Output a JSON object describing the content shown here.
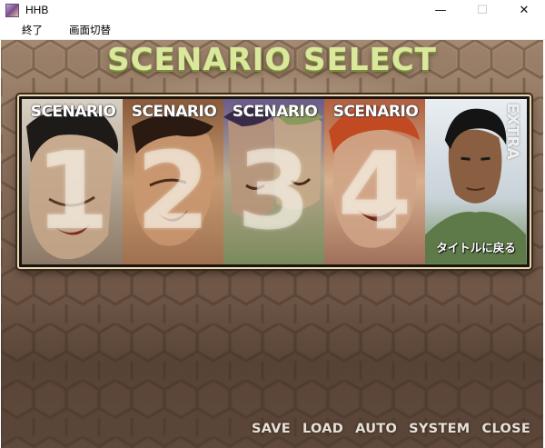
{
  "window": {
    "title": "HHB",
    "minimize_glyph": "—",
    "maximize_glyph": "☐",
    "close_glyph": "✕"
  },
  "menu": {
    "items": [
      "終了",
      "画面切替"
    ]
  },
  "game": {
    "screen_title": "SCENARIO SELECT",
    "scenarios": [
      {
        "label": "SCENARIO",
        "number": "1"
      },
      {
        "label": "SCENARIO",
        "number": "2"
      },
      {
        "label": "SCENARIO",
        "number": "3"
      },
      {
        "label": "SCENARIO",
        "number": "4"
      }
    ],
    "extra": {
      "label": "EXTRA",
      "return_text": "タイトルに戻る"
    },
    "bottom_menu": [
      "SAVE",
      "LOAD",
      "AUTO",
      "SYSTEM",
      "CLOSE"
    ]
  },
  "colors": {
    "title_green": "#d9e89a",
    "panel_border": "#e8d9b0",
    "menu_text": "#e8e1d7"
  }
}
